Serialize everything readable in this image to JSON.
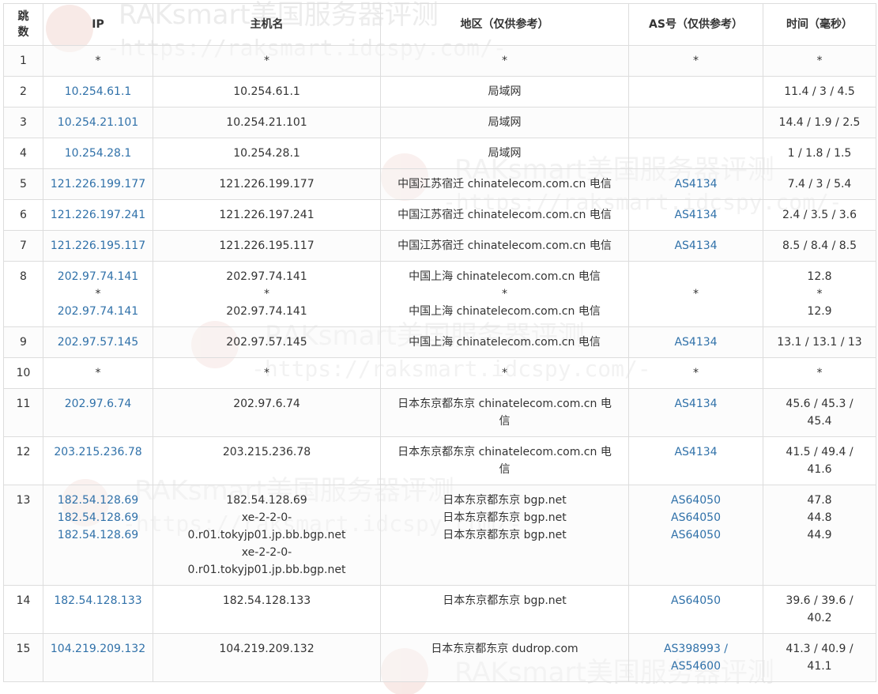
{
  "headers": {
    "hop": "跳数",
    "ip": "IP",
    "host": "主机名",
    "region": "地区（仅供参考）",
    "as": "AS号（仅供参考）",
    "time": "时间（毫秒）"
  },
  "watermark": {
    "title": "RAKsmart美国服务器评测",
    "url": "-https://raksmart.idcspy.com/-"
  },
  "colors": {
    "link": "#3071a9",
    "border": "#dddddd",
    "stripe": "#f9f9f9",
    "watermark": "#d8d8d8"
  },
  "rows": [
    {
      "hop": "1",
      "ip": "*",
      "host": "*",
      "region": "*",
      "as": "*",
      "time": "*"
    },
    {
      "hop": "2",
      "ip": "10.254.61.1",
      "host": "10.254.61.1",
      "region": "局域网",
      "as": "",
      "time": "11.4 / 3 / 4.5"
    },
    {
      "hop": "3",
      "ip": "10.254.21.101",
      "host": "10.254.21.101",
      "region": "局域网",
      "as": "",
      "time": "14.4 / 1.9 / 2.5"
    },
    {
      "hop": "4",
      "ip": "10.254.28.1",
      "host": "10.254.28.1",
      "region": "局域网",
      "as": "",
      "time": "1 / 1.8 / 1.5"
    },
    {
      "hop": "5",
      "ip": "121.226.199.177",
      "host": "121.226.199.177",
      "region": "中国江苏宿迁 chinatelecom.com.cn 电信",
      "as": "AS4134",
      "time": "7.4 / 3 / 5.4"
    },
    {
      "hop": "6",
      "ip": "121.226.197.241",
      "host": "121.226.197.241",
      "region": "中国江苏宿迁 chinatelecom.com.cn 电信",
      "as": "AS4134",
      "time": "2.4 / 3.5 / 3.6"
    },
    {
      "hop": "7",
      "ip": "121.226.195.117",
      "host": "121.226.195.117",
      "region": "中国江苏宿迁 chinatelecom.com.cn 电信",
      "as": "AS4134",
      "time": "8.5 / 8.4 / 8.5"
    },
    {
      "hop": "8",
      "ip": [
        "202.97.74.141",
        "*",
        "202.97.74.141"
      ],
      "host": [
        "202.97.74.141",
        "*",
        "202.97.74.141"
      ],
      "region": [
        "中国上海 chinatelecom.com.cn 电信",
        "*",
        "中国上海 chinatelecom.com.cn 电信"
      ],
      "as": [
        "",
        "*",
        ""
      ],
      "time": [
        "12.8",
        "*",
        "12.9"
      ]
    },
    {
      "hop": "9",
      "ip": "202.97.57.145",
      "host": "202.97.57.145",
      "region": "中国上海 chinatelecom.com.cn 电信",
      "as": "AS4134",
      "time": "13.1 / 13.1 / 13"
    },
    {
      "hop": "10",
      "ip": "*",
      "host": "*",
      "region": "*",
      "as": "*",
      "time": "*"
    },
    {
      "hop": "11",
      "ip": "202.97.6.74",
      "host": "202.97.6.74",
      "region": [
        "日本东京都东京 chinatelecom.com.cn 电",
        "信"
      ],
      "as": "AS4134",
      "time": [
        "45.6 / 45.3 /",
        "45.4"
      ]
    },
    {
      "hop": "12",
      "ip": "203.215.236.78",
      "host": "203.215.236.78",
      "region": [
        "日本东京都东京 chinatelecom.com.cn 电",
        "信"
      ],
      "as": "AS4134",
      "time": [
        "41.5 / 49.4 /",
        "41.6"
      ]
    },
    {
      "hop": "13",
      "ip": [
        "182.54.128.69",
        "182.54.128.69",
        "182.54.128.69"
      ],
      "host": [
        "182.54.128.69",
        "xe-2-2-0-",
        "0.r01.tokyjp01.jp.bb.bgp.net",
        "xe-2-2-0-",
        "0.r01.tokyjp01.jp.bb.bgp.net"
      ],
      "region": [
        "日本东京都东京 bgp.net",
        "日本东京都东京 bgp.net",
        "日本东京都东京 bgp.net"
      ],
      "as": [
        "AS64050",
        "AS64050",
        "AS64050"
      ],
      "time": [
        "47.8",
        "44.8",
        "44.9"
      ]
    },
    {
      "hop": "14",
      "ip": "182.54.128.133",
      "host": "182.54.128.133",
      "region": "日本东京都东京 bgp.net",
      "as": "AS64050",
      "time": [
        "39.6 / 39.6 /",
        "40.2"
      ]
    },
    {
      "hop": "15",
      "ip": "104.219.209.132",
      "host": "104.219.209.132",
      "region": "日本东京都东京 dudrop.com",
      "as": [
        "AS398993 /",
        "AS54600"
      ],
      "time": [
        "41.3 / 40.9 /",
        "41.1"
      ]
    }
  ]
}
